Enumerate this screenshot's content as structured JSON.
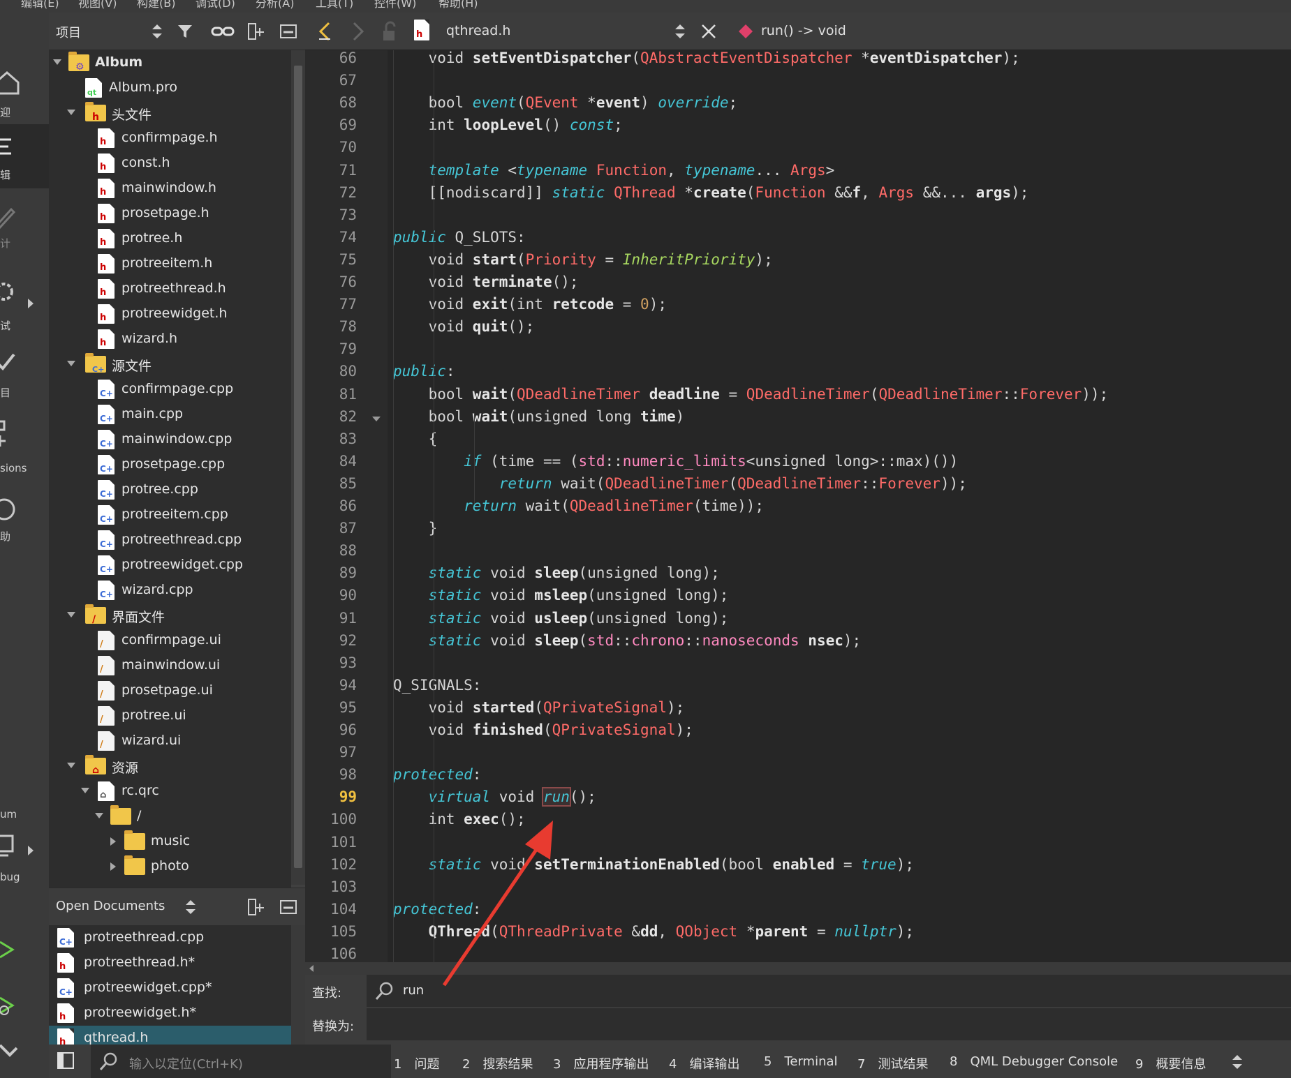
{
  "menu": [
    "编辑(E)",
    "视图(V)",
    "构建(B)",
    "调试(D)",
    "分析(A)",
    "工具(T)",
    "控件(W)",
    "帮助(H)"
  ],
  "modes": [
    {
      "label": "迎",
      "icon": "home-icon"
    },
    {
      "label": "辑",
      "icon": "edit-icon"
    },
    {
      "label": "计",
      "icon": "design-icon"
    },
    {
      "label": "试",
      "icon": "debug-icon"
    },
    {
      "label": "目",
      "icon": "projects-icon"
    },
    {
      "label": "sions",
      "icon": "extensions-icon"
    },
    {
      "label": "助",
      "icon": "help-icon"
    },
    {
      "label": "um",
      "icon": "album-kit-label"
    },
    {
      "label": "bug",
      "icon": "device-icon"
    }
  ],
  "project_panel": {
    "title": "项目",
    "tree": [
      {
        "label": "Album",
        "type": "project",
        "level": 0,
        "arrow": "open"
      },
      {
        "label": "Album.pro",
        "type": "pro",
        "level": 1
      },
      {
        "label": "头文件",
        "type": "folder-h",
        "level": 1,
        "arrow": "open"
      },
      {
        "label": "confirmpage.h",
        "type": "h",
        "level": 2
      },
      {
        "label": "const.h",
        "type": "h",
        "level": 2
      },
      {
        "label": "mainwindow.h",
        "type": "h",
        "level": 2
      },
      {
        "label": "prosetpage.h",
        "type": "h",
        "level": 2
      },
      {
        "label": "protree.h",
        "type": "h",
        "level": 2
      },
      {
        "label": "protreeitem.h",
        "type": "h",
        "level": 2
      },
      {
        "label": "protreethread.h",
        "type": "h",
        "level": 2
      },
      {
        "label": "protreewidget.h",
        "type": "h",
        "level": 2
      },
      {
        "label": "wizard.h",
        "type": "h",
        "level": 2
      },
      {
        "label": "源文件",
        "type": "folder-cpp",
        "level": 1,
        "arrow": "open"
      },
      {
        "label": "confirmpage.cpp",
        "type": "cpp",
        "level": 2
      },
      {
        "label": "main.cpp",
        "type": "cpp",
        "level": 2
      },
      {
        "label": "mainwindow.cpp",
        "type": "cpp",
        "level": 2
      },
      {
        "label": "prosetpage.cpp",
        "type": "cpp",
        "level": 2
      },
      {
        "label": "protree.cpp",
        "type": "cpp",
        "level": 2
      },
      {
        "label": "protreeitem.cpp",
        "type": "cpp",
        "level": 2
      },
      {
        "label": "protreethread.cpp",
        "type": "cpp",
        "level": 2
      },
      {
        "label": "protreewidget.cpp",
        "type": "cpp",
        "level": 2
      },
      {
        "label": "wizard.cpp",
        "type": "cpp",
        "level": 2
      },
      {
        "label": "界面文件",
        "type": "folder-ui",
        "level": 1,
        "arrow": "open"
      },
      {
        "label": "confirmpage.ui",
        "type": "ui",
        "level": 2
      },
      {
        "label": "mainwindow.ui",
        "type": "ui",
        "level": 2
      },
      {
        "label": "prosetpage.ui",
        "type": "ui",
        "level": 2
      },
      {
        "label": "protree.ui",
        "type": "ui",
        "level": 2
      },
      {
        "label": "wizard.ui",
        "type": "ui",
        "level": 2
      },
      {
        "label": "资源",
        "type": "folder-res",
        "level": 1,
        "arrow": "open"
      },
      {
        "label": "rc.qrc",
        "type": "qrc",
        "level": 2,
        "arrow": "open"
      },
      {
        "label": "/",
        "type": "folder",
        "level": 3,
        "arrow": "open"
      },
      {
        "label": "music",
        "type": "folder",
        "level": 4,
        "arrow": "closed"
      },
      {
        "label": "photo",
        "type": "folder",
        "level": 4,
        "arrow": "closed"
      }
    ]
  },
  "open_documents": {
    "title": "Open Documents",
    "items": [
      {
        "label": "protreethread.cpp",
        "type": "cpp",
        "selected": false
      },
      {
        "label": "protreethread.h*",
        "type": "h",
        "selected": false
      },
      {
        "label": "protreewidget.cpp*",
        "type": "cpp",
        "selected": false
      },
      {
        "label": "protreewidget.h*",
        "type": "h",
        "selected": false
      },
      {
        "label": "qthread.h",
        "type": "h",
        "selected": true
      }
    ]
  },
  "locator": {
    "placeholder": "输入以定位(Ctrl+K)"
  },
  "editor": {
    "filename": "qthread.h",
    "function": "run() -> void",
    "current_line": "99",
    "lines": [
      {
        "n": "66",
        "fold": false,
        "parts": [
          [
            "kw",
            "    void "
          ],
          [
            "fnb",
            "setEventDispatcher"
          ],
          [
            "kw",
            "("
          ],
          [
            "cls",
            "QAbstractEventDispatcher"
          ],
          [
            "kw",
            " *"
          ],
          [
            "prm",
            "eventDispatcher"
          ],
          [
            "kw",
            ");"
          ]
        ]
      },
      {
        "n": "67",
        "parts": []
      },
      {
        "n": "68",
        "parts": [
          [
            "kw",
            "    bool "
          ],
          [
            "it",
            "event"
          ],
          [
            "kw",
            "("
          ],
          [
            "cls",
            "QEvent"
          ],
          [
            "kw",
            " *"
          ],
          [
            "prm",
            "event"
          ],
          [
            "kw",
            ") "
          ],
          [
            "it",
            "override"
          ],
          [
            "kw",
            ";"
          ]
        ]
      },
      {
        "n": "69",
        "parts": [
          [
            "kw",
            "    int "
          ],
          [
            "fnb",
            "loopLevel"
          ],
          [
            "kw",
            "() "
          ],
          [
            "it",
            "const"
          ],
          [
            "kw",
            ";"
          ]
        ]
      },
      {
        "n": "70",
        "parts": []
      },
      {
        "n": "71",
        "parts": [
          [
            "kw",
            "    "
          ],
          [
            "it",
            "template"
          ],
          [
            "kw",
            " <"
          ],
          [
            "it",
            "typename"
          ],
          [
            "kw",
            " "
          ],
          [
            "cls",
            "Function"
          ],
          [
            "kw",
            ", "
          ],
          [
            "it",
            "typename"
          ],
          [
            "kw",
            "... "
          ],
          [
            "cls",
            "Args"
          ],
          [
            "kw",
            ">"
          ]
        ]
      },
      {
        "n": "72",
        "parts": [
          [
            "kw",
            "    [[nodiscard]] "
          ],
          [
            "it",
            "static"
          ],
          [
            "kw",
            " "
          ],
          [
            "cls",
            "QThread"
          ],
          [
            "kw",
            " *"
          ],
          [
            "fnb",
            "create"
          ],
          [
            "kw",
            "("
          ],
          [
            "cls",
            "Function"
          ],
          [
            "kw",
            " &&"
          ],
          [
            "prm",
            "f"
          ],
          [
            "kw",
            ", "
          ],
          [
            "cls",
            "Args"
          ],
          [
            "kw",
            " &&... "
          ],
          [
            "prm",
            "args"
          ],
          [
            "kw",
            ");"
          ]
        ]
      },
      {
        "n": "73",
        "parts": []
      },
      {
        "n": "74",
        "parts": [
          [
            "it",
            "public"
          ],
          [
            "kw",
            " Q_SLOTS:"
          ]
        ]
      },
      {
        "n": "75",
        "parts": [
          [
            "kw",
            "    void "
          ],
          [
            "fnb",
            "start"
          ],
          [
            "kw",
            "("
          ],
          [
            "cls",
            "Priority"
          ],
          [
            "kw",
            " = "
          ],
          [
            "en",
            "InheritPriority"
          ],
          [
            "kw",
            ");"
          ]
        ]
      },
      {
        "n": "76",
        "parts": [
          [
            "kw",
            "    void "
          ],
          [
            "fnb",
            "terminate"
          ],
          [
            "kw",
            "();"
          ]
        ]
      },
      {
        "n": "77",
        "parts": [
          [
            "kw",
            "    void "
          ],
          [
            "fnb",
            "exit"
          ],
          [
            "kw",
            "(int "
          ],
          [
            "prm",
            "retcode"
          ],
          [
            "kw",
            " = "
          ],
          [
            "nm",
            "0"
          ],
          [
            "kw",
            ");"
          ]
        ]
      },
      {
        "n": "78",
        "parts": [
          [
            "kw",
            "    void "
          ],
          [
            "fnb",
            "quit"
          ],
          [
            "kw",
            "();"
          ]
        ]
      },
      {
        "n": "79",
        "parts": []
      },
      {
        "n": "80",
        "parts": [
          [
            "it",
            "public"
          ],
          [
            "kw",
            ":"
          ]
        ]
      },
      {
        "n": "81",
        "parts": [
          [
            "kw",
            "    bool "
          ],
          [
            "fnb",
            "wait"
          ],
          [
            "kw",
            "("
          ],
          [
            "cls",
            "QDeadlineTimer"
          ],
          [
            "kw",
            " "
          ],
          [
            "prm",
            "deadline"
          ],
          [
            "kw",
            " = "
          ],
          [
            "cls",
            "QDeadlineTimer"
          ],
          [
            "kw",
            "("
          ],
          [
            "cls",
            "QDeadlineTimer"
          ],
          [
            "kw",
            "::"
          ],
          [
            "cls",
            "Forever"
          ],
          [
            "kw",
            "));"
          ]
        ]
      },
      {
        "n": "82",
        "fold": true,
        "parts": [
          [
            "kw",
            "    bool "
          ],
          [
            "fnb",
            "wait"
          ],
          [
            "kw",
            "(unsigned long "
          ],
          [
            "prm",
            "time"
          ],
          [
            "kw",
            ")"
          ]
        ]
      },
      {
        "n": "83",
        "parts": [
          [
            "kw",
            "    {"
          ]
        ]
      },
      {
        "n": "84",
        "parts": [
          [
            "kw",
            "        "
          ],
          [
            "it",
            "if"
          ],
          [
            "kw",
            " (time == ("
          ],
          [
            "ns",
            "std"
          ],
          [
            "kw",
            "::"
          ],
          [
            "ns",
            "numeric_limits"
          ],
          [
            "kw",
            "<unsigned long>::max)())"
          ]
        ]
      },
      {
        "n": "85",
        "parts": [
          [
            "kw",
            "            "
          ],
          [
            "it",
            "return"
          ],
          [
            "kw",
            " wait("
          ],
          [
            "cls",
            "QDeadlineTimer"
          ],
          [
            "kw",
            "("
          ],
          [
            "cls",
            "QDeadlineTimer"
          ],
          [
            "kw",
            "::"
          ],
          [
            "cls",
            "Forever"
          ],
          [
            "kw",
            "));"
          ]
        ]
      },
      {
        "n": "86",
        "parts": [
          [
            "kw",
            "        "
          ],
          [
            "it",
            "return"
          ],
          [
            "kw",
            " wait("
          ],
          [
            "cls",
            "QDeadlineTimer"
          ],
          [
            "kw",
            "(time));"
          ]
        ]
      },
      {
        "n": "87",
        "parts": [
          [
            "kw",
            "    }"
          ]
        ]
      },
      {
        "n": "88",
        "parts": []
      },
      {
        "n": "89",
        "parts": [
          [
            "kw",
            "    "
          ],
          [
            "it",
            "static"
          ],
          [
            "kw",
            " void "
          ],
          [
            "fnb",
            "sleep"
          ],
          [
            "kw",
            "(unsigned long);"
          ]
        ]
      },
      {
        "n": "90",
        "parts": [
          [
            "kw",
            "    "
          ],
          [
            "it",
            "static"
          ],
          [
            "kw",
            " void "
          ],
          [
            "fnb",
            "msleep"
          ],
          [
            "kw",
            "(unsigned long);"
          ]
        ]
      },
      {
        "n": "91",
        "parts": [
          [
            "kw",
            "    "
          ],
          [
            "it",
            "static"
          ],
          [
            "kw",
            " void "
          ],
          [
            "fnb",
            "usleep"
          ],
          [
            "kw",
            "(unsigned long);"
          ]
        ]
      },
      {
        "n": "92",
        "parts": [
          [
            "kw",
            "    "
          ],
          [
            "it",
            "static"
          ],
          [
            "kw",
            " void "
          ],
          [
            "fnb",
            "sleep"
          ],
          [
            "kw",
            "("
          ],
          [
            "ns",
            "std"
          ],
          [
            "kw",
            "::"
          ],
          [
            "ns",
            "chrono"
          ],
          [
            "kw",
            "::"
          ],
          [
            "ns",
            "nanoseconds"
          ],
          [
            "kw",
            " "
          ],
          [
            "prm",
            "nsec"
          ],
          [
            "kw",
            ");"
          ]
        ]
      },
      {
        "n": "93",
        "parts": []
      },
      {
        "n": "94",
        "parts": [
          [
            "kw",
            "Q_SIGNALS:"
          ]
        ]
      },
      {
        "n": "95",
        "parts": [
          [
            "kw",
            "    void "
          ],
          [
            "fnb",
            "started"
          ],
          [
            "kw",
            "("
          ],
          [
            "cls",
            "QPrivateSignal"
          ],
          [
            "kw",
            ");"
          ]
        ]
      },
      {
        "n": "96",
        "parts": [
          [
            "kw",
            "    void "
          ],
          [
            "fnb",
            "finished"
          ],
          [
            "kw",
            "("
          ],
          [
            "cls",
            "QPrivateSignal"
          ],
          [
            "kw",
            ");"
          ]
        ]
      },
      {
        "n": "97",
        "parts": []
      },
      {
        "n": "98",
        "parts": [
          [
            "it",
            "protected"
          ],
          [
            "kw",
            ":"
          ]
        ]
      },
      {
        "n": "99",
        "parts": [
          [
            "kw",
            "    "
          ],
          [
            "it",
            "virtual"
          ],
          [
            "kw",
            " void "
          ],
          [
            "it hl",
            "run"
          ],
          [
            "kw",
            "();"
          ]
        ]
      },
      {
        "n": "100",
        "parts": [
          [
            "kw",
            "    int "
          ],
          [
            "fnb",
            "exec"
          ],
          [
            "kw",
            "();"
          ]
        ]
      },
      {
        "n": "101",
        "parts": []
      },
      {
        "n": "102",
        "parts": [
          [
            "kw",
            "    "
          ],
          [
            "it",
            "static"
          ],
          [
            "kw",
            " void "
          ],
          [
            "fnb",
            "setTerminationEnabled"
          ],
          [
            "kw",
            "(bool "
          ],
          [
            "prm",
            "enabled"
          ],
          [
            "kw",
            " = "
          ],
          [
            "it",
            "true"
          ],
          [
            "kw",
            ");"
          ]
        ]
      },
      {
        "n": "103",
        "parts": []
      },
      {
        "n": "104",
        "parts": [
          [
            "it",
            "protected"
          ],
          [
            "kw",
            ":"
          ]
        ]
      },
      {
        "n": "105",
        "parts": [
          [
            "kw",
            "    "
          ],
          [
            "fnb",
            "QThread"
          ],
          [
            "kw",
            "("
          ],
          [
            "cls",
            "QThreadPrivate"
          ],
          [
            "kw",
            " &"
          ],
          [
            "prm",
            "dd"
          ],
          [
            "kw",
            ", "
          ],
          [
            "cls",
            "QObject"
          ],
          [
            "kw",
            " *"
          ],
          [
            "prm",
            "parent"
          ],
          [
            "kw",
            " = "
          ],
          [
            "it",
            "nullptr"
          ],
          [
            "kw",
            ");"
          ]
        ]
      },
      {
        "n": "106",
        "parts": []
      }
    ]
  },
  "find": {
    "find_label": "查找:",
    "find_value": "run",
    "replace_label": "替换为:"
  },
  "output_tabs": [
    {
      "num": "1",
      "label": "问题"
    },
    {
      "num": "2",
      "label": "搜索结果"
    },
    {
      "num": "3",
      "label": "应用程序输出"
    },
    {
      "num": "4",
      "label": "编译输出"
    },
    {
      "num": "5",
      "label": "Terminal"
    },
    {
      "num": "7",
      "label": "测试结果"
    },
    {
      "num": "8",
      "label": "QML Debugger Console"
    },
    {
      "num": "9",
      "label": "概要信息"
    }
  ],
  "colors": {
    "selection": "#2b5d6b",
    "annotation_arrow": "#e83b30",
    "current_line": "#f0c040"
  }
}
